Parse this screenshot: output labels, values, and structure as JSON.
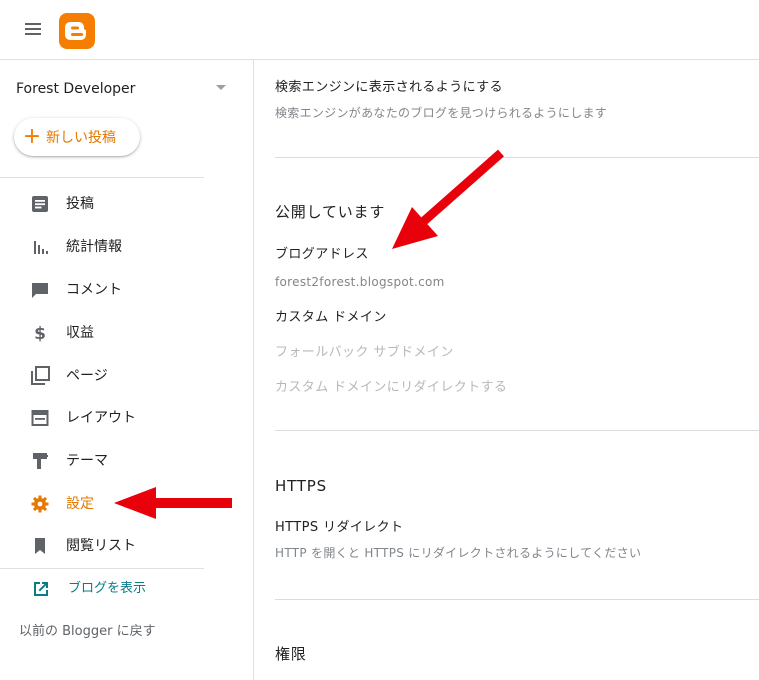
{
  "app": {
    "brand": "Blogger",
    "brand_color": "#f57d00"
  },
  "sidebar": {
    "blog_name": "Forest Developer",
    "new_post_label": "新しい投稿",
    "items": [
      {
        "label": "投稿",
        "icon": "posts-icon"
      },
      {
        "label": "統計情報",
        "icon": "stats-icon"
      },
      {
        "label": "コメント",
        "icon": "comment-icon"
      },
      {
        "label": "収益",
        "icon": "dollar-icon"
      },
      {
        "label": "ページ",
        "icon": "pages-icon"
      },
      {
        "label": "レイアウト",
        "icon": "layout-icon"
      },
      {
        "label": "テーマ",
        "icon": "theme-icon"
      },
      {
        "label": "設定",
        "icon": "gear-icon",
        "active": true
      },
      {
        "label": "閲覧リスト",
        "icon": "bookmark-icon"
      }
    ],
    "view_blog_label": "ブログを表示",
    "legacy_label": "以前の Blogger に戻す"
  },
  "main": {
    "search_visible": {
      "title": "検索エンジンに表示されるようにする",
      "description": "検索エンジンがあなたのブログを見つけられるようにします"
    },
    "publishing": {
      "section_title": "公開しています",
      "blog_address_label": "ブログアドレス",
      "blog_address_value": "forest2forest.blogspot.com",
      "custom_domain_label": "カスタム ドメイン",
      "fallback_subdomain_label": "フォールバック サブドメイン",
      "redirect_custom_domain_label": "カスタム ドメインにリダイレクトする"
    },
    "https": {
      "section_title": "HTTPS",
      "redirect_label": "HTTPS リダイレクト",
      "redirect_description": "HTTP を開くと HTTPS にリダイレクトされるようにしてください"
    },
    "permissions": {
      "section_title": "権限"
    }
  },
  "colors": {
    "accent_orange": "#e67700",
    "annotation_red": "#e8000b",
    "link_teal": "#0a7c86"
  }
}
